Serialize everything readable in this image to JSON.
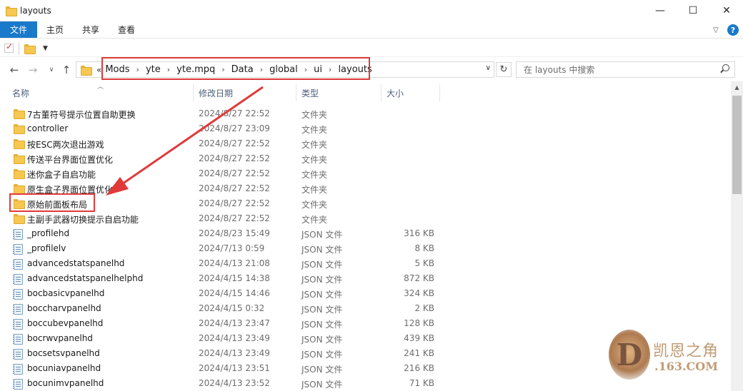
{
  "window": {
    "title": "layouts",
    "controls": {
      "minimize": "—",
      "maximize": "☐",
      "close": "✕"
    }
  },
  "ribbon": {
    "tabs": [
      "文件",
      "主页",
      "共享",
      "查看"
    ],
    "collapse_icon": "chevron-down-icon",
    "help_label": "?"
  },
  "address": {
    "overflow": "«",
    "crumbs": [
      "Mods",
      "yte",
      "yte.mpq",
      "Data",
      "global",
      "ui",
      "layouts"
    ],
    "separator": "›"
  },
  "search": {
    "placeholder": "在 layouts 中搜索"
  },
  "columns": {
    "name": "名称",
    "date": "修改日期",
    "type": "类型",
    "size": "大小"
  },
  "files": [
    {
      "name": "7古董符号提示位置自助更换",
      "date": "2024/8/27 22:52",
      "type": "文件夹",
      "size": "",
      "kind": "folder"
    },
    {
      "name": "controller",
      "date": "2024/8/27 23:09",
      "type": "文件夹",
      "size": "",
      "kind": "folder"
    },
    {
      "name": "按ESC两次退出游戏",
      "date": "2024/8/27 22:52",
      "type": "文件夹",
      "size": "",
      "kind": "folder"
    },
    {
      "name": "传送平台界面位置优化",
      "date": "2024/8/27 22:52",
      "type": "文件夹",
      "size": "",
      "kind": "folder"
    },
    {
      "name": "迷你盒子自启功能",
      "date": "2024/8/27 22:52",
      "type": "文件夹",
      "size": "",
      "kind": "folder"
    },
    {
      "name": "原生盒子界面位置优化",
      "date": "2024/8/27 22:52",
      "type": "文件夹",
      "size": "",
      "kind": "folder"
    },
    {
      "name": "原始前面板布局",
      "date": "2024/8/27 22:52",
      "type": "文件夹",
      "size": "",
      "kind": "folder"
    },
    {
      "name": "主副手武器切换提示自启功能",
      "date": "2024/8/27 22:52",
      "type": "文件夹",
      "size": "",
      "kind": "folder"
    },
    {
      "name": "_profilehd",
      "date": "2024/8/23 15:49",
      "type": "JSON 文件",
      "size": "316 KB",
      "kind": "file"
    },
    {
      "name": "_profilelv",
      "date": "2024/7/13 0:59",
      "type": "JSON 文件",
      "size": "8 KB",
      "kind": "file"
    },
    {
      "name": "advancedstatspanelhd",
      "date": "2024/4/13 21:08",
      "type": "JSON 文件",
      "size": "5 KB",
      "kind": "file"
    },
    {
      "name": "advancedstatspanelhelphd",
      "date": "2024/4/15 14:38",
      "type": "JSON 文件",
      "size": "872 KB",
      "kind": "file"
    },
    {
      "name": "bocbasicvpanelhd",
      "date": "2024/4/15 14:46",
      "type": "JSON 文件",
      "size": "324 KB",
      "kind": "file"
    },
    {
      "name": "boccharvpanelhd",
      "date": "2024/4/15 0:32",
      "type": "JSON 文件",
      "size": "2 KB",
      "kind": "file"
    },
    {
      "name": "boccubevpanelhd",
      "date": "2024/4/13 23:47",
      "type": "JSON 文件",
      "size": "128 KB",
      "kind": "file"
    },
    {
      "name": "bocrwvpanelhd",
      "date": "2024/4/13 23:49",
      "type": "JSON 文件",
      "size": "439 KB",
      "kind": "file"
    },
    {
      "name": "bocsetsvpanelhd",
      "date": "2024/4/13 23:49",
      "type": "JSON 文件",
      "size": "241 KB",
      "kind": "file"
    },
    {
      "name": "bocuniavpanelhd",
      "date": "2024/4/13 23:51",
      "type": "JSON 文件",
      "size": "216 KB",
      "kind": "file"
    },
    {
      "name": "bocunimvpanelhd",
      "date": "2024/4/13 23:52",
      "type": "JSON 文件",
      "size": "71 KB",
      "kind": "file"
    }
  ],
  "annotation": {
    "color": "#e03a3a"
  },
  "watermark": {
    "letter": "D",
    "name": "凯恩之角",
    "domain": ".163.COM"
  },
  "colors": {
    "file_tab": "#1979ca",
    "folder": "#f6c751",
    "header_text": "#4c607a"
  }
}
